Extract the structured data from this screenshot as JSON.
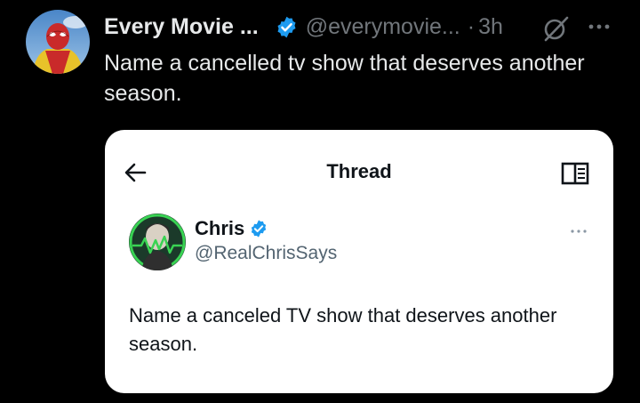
{
  "tweet": {
    "display_name": "Every Movie ...",
    "handle": "@everymovie...",
    "separator": "·",
    "time": "3h",
    "text": "Name a cancelled tv show that deserves another season."
  },
  "card": {
    "title": "Thread",
    "author_name": "Chris",
    "author_handle": "@RealChrisSays",
    "text": "Name a canceled TV show that deserves another season."
  },
  "colors": {
    "background": "#000000",
    "verified": "#1d9bf0",
    "card_background": "#ffffff",
    "secondary_text": "#71767b"
  },
  "icons": {
    "verified": "verified-badge-icon",
    "grok": "grok-icon",
    "more": "more-options-icon",
    "back": "back-arrow-icon",
    "reader": "reader-mode-icon"
  }
}
